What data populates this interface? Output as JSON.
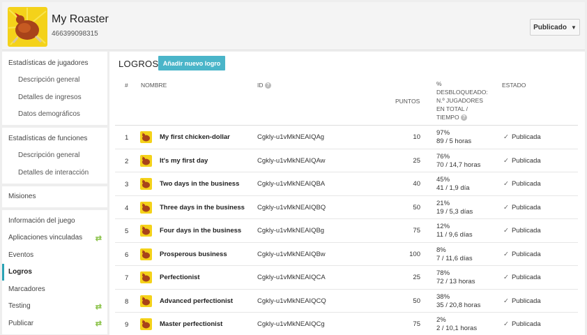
{
  "app": {
    "name": "My Roaster",
    "id": "466399098315",
    "publish_button": "Publicado",
    "caret": "▼"
  },
  "sidebar": {
    "groups": [
      {
        "items": [
          {
            "label": "Estadísticas de jugadores",
            "sub": false
          },
          {
            "label": "Descripción general",
            "sub": true
          },
          {
            "label": "Detalles de ingresos",
            "sub": true
          },
          {
            "label": "Datos demográficos",
            "sub": true
          }
        ]
      },
      {
        "items": [
          {
            "label": "Estadísticas de funciones",
            "sub": false
          },
          {
            "label": "Descripción general",
            "sub": true
          },
          {
            "label": "Detalles de interacción",
            "sub": true
          }
        ]
      },
      {
        "items": [
          {
            "label": "Misiones",
            "sub": false
          }
        ]
      },
      {
        "items": [
          {
            "label": "Información del juego",
            "sub": false
          },
          {
            "label": "Aplicaciones vinculadas",
            "sub": false,
            "swap": true
          },
          {
            "label": "Eventos",
            "sub": false
          },
          {
            "label": "Logros",
            "sub": false,
            "active": true
          },
          {
            "label": "Marcadores",
            "sub": false
          },
          {
            "label": "Testing",
            "sub": false,
            "swap": true
          },
          {
            "label": "Publicar",
            "sub": false,
            "swap": true
          }
        ]
      }
    ],
    "swap_icon": "⇄"
  },
  "main": {
    "title": "LOGROS",
    "add_button": "Añadir nuevo logro",
    "columns": {
      "num": "#",
      "name": "NOMBRE",
      "id": "ID",
      "points": "PUNTOS",
      "pct": [
        "%",
        "DESBLOQUEADO:",
        "N.º JUGADORES",
        "EN TOTAL /",
        "TIEMPO"
      ],
      "state": "ESTADO"
    },
    "help_icon": "?",
    "check_icon": "✓",
    "rows": [
      {
        "num": "1",
        "name": "My first chicken-dollar",
        "id": "Cgkly-u1vMkNEAIQAg",
        "points": "10",
        "pct": "97%",
        "players": "89 / 5 horas",
        "state": "Publicada"
      },
      {
        "num": "2",
        "name": "It's my first day",
        "id": "Cgkly-u1vMkNEAIQAw",
        "points": "25",
        "pct": "76%",
        "players": "70 / 14,7 horas",
        "state": "Publicada"
      },
      {
        "num": "3",
        "name": "Two days in the business",
        "id": "Cgkly-u1vMkNEAIQBA",
        "points": "40",
        "pct": "45%",
        "players": "41 / 1,9 día",
        "state": "Publicada"
      },
      {
        "num": "4",
        "name": "Three days in the business",
        "id": "Cgkly-u1vMkNEAIQBQ",
        "points": "50",
        "pct": "21%",
        "players": "19 / 5,3 días",
        "state": "Publicada"
      },
      {
        "num": "5",
        "name": "Four days in the business",
        "id": "Cgkly-u1vMkNEAIQBg",
        "points": "75",
        "pct": "12%",
        "players": "11 / 9,6 días",
        "state": "Publicada"
      },
      {
        "num": "6",
        "name": "Prosperous business",
        "id": "Cgkly-u1vMkNEAIQBw",
        "points": "100",
        "pct": "8%",
        "players": "7 / 11,6 días",
        "state": "Publicada"
      },
      {
        "num": "7",
        "name": "Perfectionist",
        "id": "Cgkly-u1vMkNEAIQCA",
        "points": "25",
        "pct": "78%",
        "players": "72 / 13 horas",
        "state": "Publicada"
      },
      {
        "num": "8",
        "name": "Advanced perfectionist",
        "id": "Cgkly-u1vMkNEAIQCQ",
        "points": "50",
        "pct": "38%",
        "players": "35 / 20,8 horas",
        "state": "Publicada"
      },
      {
        "num": "9",
        "name": "Master perfectionist",
        "id": "Cgkly-u1vMkNEAIQCg",
        "points": "75",
        "pct": "2%",
        "players": "2 / 10,1 horas",
        "state": "Publicada"
      }
    ]
  }
}
